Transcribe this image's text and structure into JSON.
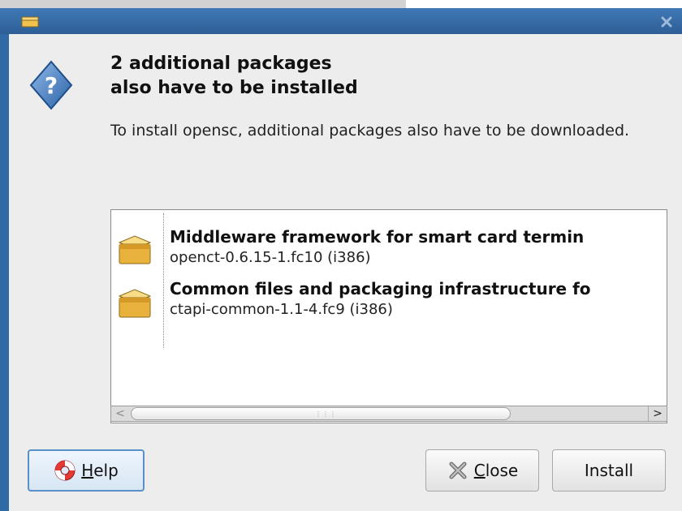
{
  "window": {
    "icons": {
      "title": "package-icon",
      "close": "close-x-icon"
    }
  },
  "dialog": {
    "icon": "question-icon",
    "heading_line1": "2 additional packages",
    "heading_line2": "also have to be installed",
    "message": "To install opensc, additional packages also have to be downloaded."
  },
  "packages": [
    {
      "name": "Middleware framework for smart card termin",
      "version": "openct-0.6.15-1.fc10 (i386)",
      "icon": "package-box-icon"
    },
    {
      "name": "Common files and packaging infrastructure fo",
      "version": "ctapi-common-1.1-4.fc9 (i386)",
      "icon": "package-box-icon"
    }
  ],
  "scrollbar": {
    "left_arrow": "<",
    "right_arrow": ">"
  },
  "buttons": {
    "help": {
      "mnemonic": "H",
      "rest": "elp",
      "icon": "lifebuoy-icon"
    },
    "close": {
      "mnemonic": "C",
      "rest": "lose",
      "icon": "close-x-icon"
    },
    "install": {
      "label": "Install"
    }
  },
  "colors": {
    "titlebar": "#3f79b6",
    "accent_strip": "#2f6aa7",
    "dialog_bg": "#ededed"
  }
}
